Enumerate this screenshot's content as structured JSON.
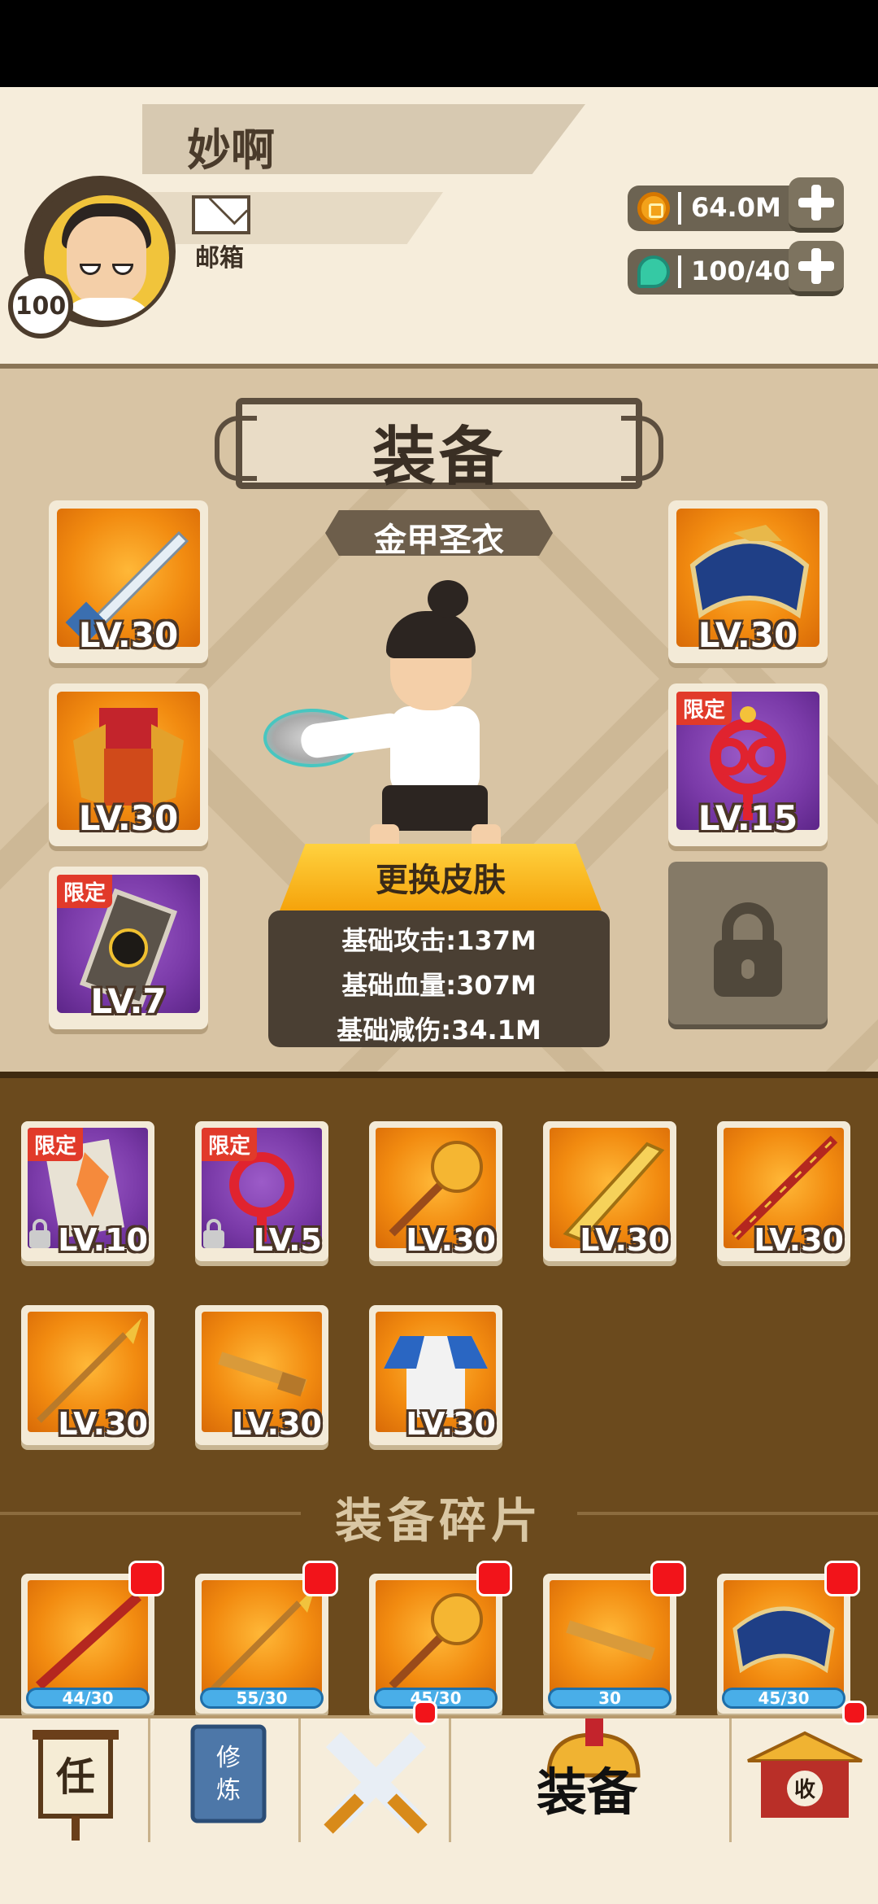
{
  "player": {
    "name": "妙啊",
    "level": "100",
    "mail_label": "邮箱"
  },
  "resources": {
    "gold": "64.0M",
    "gems": "100/40"
  },
  "panel": {
    "title": "装备",
    "set_name": "金甲圣衣",
    "skin_button": "更换皮肤",
    "stats": [
      "基础攻击:137M",
      "基础血量:307M",
      "基础减伤:34.1M"
    ]
  },
  "equipped": {
    "left": [
      {
        "item": "sword",
        "level": "LV.30",
        "limited": false
      },
      {
        "item": "armor",
        "level": "LV.30",
        "limited": false
      },
      {
        "item": "scroll",
        "level": "LV.7",
        "limited": true,
        "tag": "限定"
      }
    ],
    "right": [
      {
        "item": "bow",
        "level": "LV.30",
        "limited": false
      },
      {
        "item": "chinese-knot",
        "level": "LV.15",
        "limited": true,
        "tag": "限定"
      }
    ]
  },
  "inventory": [
    {
      "item": "banner",
      "level": "LV.10",
      "limited": true,
      "tag": "限定",
      "locked": true
    },
    {
      "item": "chinese-knot",
      "level": "LV.5",
      "limited": true,
      "tag": "限定",
      "locked": true
    },
    {
      "item": "mace",
      "level": "LV.30",
      "limited": false
    },
    {
      "item": "broadsword",
      "level": "LV.30",
      "limited": false
    },
    {
      "item": "staff",
      "level": "LV.30",
      "limited": false
    },
    {
      "item": "spear",
      "level": "LV.30",
      "limited": false
    },
    {
      "item": "key",
      "level": "LV.30",
      "limited": false
    },
    {
      "item": "robe",
      "level": "LV.30",
      "limited": false
    }
  ],
  "fragments": {
    "title": "装备碎片",
    "items": [
      {
        "item": "staff",
        "progress": "44/30"
      },
      {
        "item": "spear",
        "progress": "55/30"
      },
      {
        "item": "mace",
        "progress": "45/30"
      },
      {
        "item": "key",
        "progress": "30"
      },
      {
        "item": "bow",
        "progress": "45/30"
      }
    ]
  },
  "nav": {
    "tasks_glyph": "任",
    "train_glyph": "修炼",
    "active_label": "装备",
    "shop_glyph": "收"
  },
  "colors": {
    "accent_orange": "#f28b10",
    "limited_purple": "#7a3aa8",
    "badge_red": "#f2141a",
    "panel_bg": "#d8c4a4",
    "inventory_bg": "#6b4a1d"
  }
}
